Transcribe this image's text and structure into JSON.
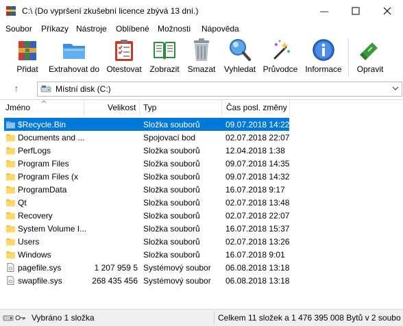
{
  "window": {
    "title": "C:\\ (Do vypršení zkušební licence zbývá 13 dní.)",
    "minimize_glyph": "—",
    "maximize_glyph": "☐",
    "close_glyph": "✕"
  },
  "menu": [
    "Soubor",
    "Příkazy",
    "Nástroje",
    "Oblíbené",
    "Možnosti",
    "Nápověda"
  ],
  "toolbar": [
    {
      "label": "Přidat",
      "icon": "add-archive-icon"
    },
    {
      "label": "Extrahovat do",
      "icon": "extract-folder-icon"
    },
    {
      "label": "Otestovat",
      "icon": "test-clipboard-icon"
    },
    {
      "label": "Zobrazit",
      "icon": "view-book-icon"
    },
    {
      "label": "Smazat",
      "icon": "trash-icon"
    },
    {
      "label": "Vyhledat",
      "icon": "magnifier-icon"
    },
    {
      "label": "Průvodce",
      "icon": "wizard-wand-icon"
    },
    {
      "label": "Informace",
      "icon": "info-icon"
    },
    {
      "label": "Opravit",
      "icon": "repair-kit-icon"
    }
  ],
  "address": {
    "up_glyph": "↑",
    "path": "Místní disk (C:)"
  },
  "columns": {
    "name": "Jméno",
    "size": "Velikost",
    "type": "Typ",
    "modified": "Čas posl. změny"
  },
  "rows": [
    {
      "name": "$Recycle.Bin",
      "size": "",
      "type": "Složka souborů",
      "modified": "09.07.2018 14:22",
      "icon": "folder-icon",
      "selected": true
    },
    {
      "name": "Documents and ...",
      "size": "",
      "type": "Spojovací bod",
      "modified": "02.07.2018 22:07",
      "icon": "folder-icon"
    },
    {
      "name": "PerfLogs",
      "size": "",
      "type": "Složka souborů",
      "modified": "12.04.2018 1:38",
      "icon": "folder-icon"
    },
    {
      "name": "Program Files",
      "size": "",
      "type": "Složka souborů",
      "modified": "09.07.2018 14:35",
      "icon": "folder-icon"
    },
    {
      "name": "Program Files (x",
      "size": "",
      "type": "Složka souborů",
      "modified": "09.07.2018 14:32",
      "icon": "folder-icon"
    },
    {
      "name": "ProgramData",
      "size": "",
      "type": "Složka souborů",
      "modified": "16.07.2018 9:17",
      "icon": "folder-icon"
    },
    {
      "name": "Qt",
      "size": "",
      "type": "Složka souborů",
      "modified": "02.07.2018 13:48",
      "icon": "folder-icon"
    },
    {
      "name": "Recovery",
      "size": "",
      "type": "Složka souborů",
      "modified": "02.07.2018 22:07",
      "icon": "folder-icon"
    },
    {
      "name": "System Volume I...",
      "size": "",
      "type": "Složka souborů",
      "modified": "16.07.2018 15:37",
      "icon": "folder-icon"
    },
    {
      "name": "Users",
      "size": "",
      "type": "Složka souborů",
      "modified": "02.07.2018 13:26",
      "icon": "folder-icon"
    },
    {
      "name": "Windows",
      "size": "",
      "type": "Složka souborů",
      "modified": "16.07.2018 9:01",
      "icon": "folder-icon"
    },
    {
      "name": "pagefile.sys",
      "size": "1 207 959 5",
      "type": "Systémový soubor",
      "modified": "06.08.2018 13:18",
      "icon": "system-file-icon"
    },
    {
      "name": "swapfile.sys",
      "size": "268 435 456",
      "type": "Systémový soubor",
      "modified": "06.08.2018 13:18",
      "icon": "system-file-icon"
    }
  ],
  "status": {
    "left": "Vybráno 1 složka",
    "right": "Celkem 11 složek a 1 476 395 008 Bytů v 2 soubo"
  },
  "colors": {
    "selection": "#0078d7",
    "folder": "#f5c542",
    "status_bg": "#f0f0f0"
  }
}
